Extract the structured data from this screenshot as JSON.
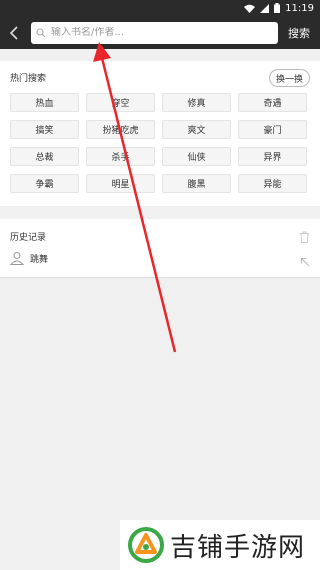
{
  "status_bar": {
    "time": "11:19"
  },
  "header": {
    "search_placeholder": "输入书名/作者...",
    "search_button": "搜索"
  },
  "hot": {
    "title": "热门搜索",
    "refresh_label": "换一换",
    "tags": [
      "热血",
      "穿空",
      "修真",
      "奇遇",
      "搞笑",
      "扮猪吃虎",
      "爽文",
      "豪门",
      "总裁",
      "杀手",
      "仙侠",
      "异界",
      "争霸",
      "明星",
      "腹黑",
      "异能"
    ]
  },
  "history": {
    "title": "历史记录",
    "items": [
      {
        "label": "跳舞"
      }
    ]
  },
  "watermark": {
    "text": "吉铺手游网"
  },
  "colors": {
    "header_bg": "#2b2b2b",
    "annotation": "#e8262b"
  }
}
